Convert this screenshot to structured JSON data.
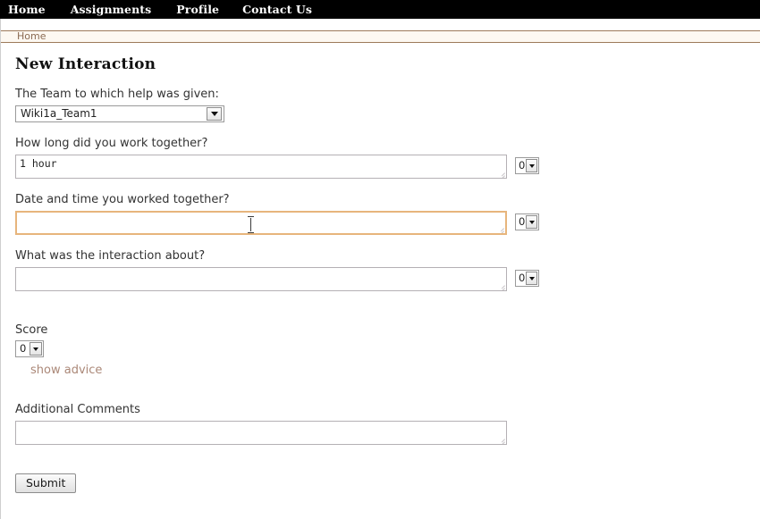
{
  "navbar": {
    "items": [
      {
        "label": "Home"
      },
      {
        "label": "Assignments"
      },
      {
        "label": "Profile"
      },
      {
        "label": "Contact Us"
      }
    ]
  },
  "breadcrumb": {
    "label": "Home"
  },
  "page": {
    "title": "New Interaction"
  },
  "form": {
    "team": {
      "label": "The Team to which help was given:",
      "value": "Wiki1a_Team1"
    },
    "duration": {
      "label": "How long did you work together?",
      "value": "1 hour",
      "placeholder": "",
      "counter": "0"
    },
    "datetime": {
      "label": "Date and time you worked together?",
      "value": "",
      "placeholder": "",
      "counter": "0"
    },
    "topic": {
      "label": "What was the interaction about?",
      "value": "",
      "placeholder": "",
      "counter": "0"
    },
    "score": {
      "label": "Score",
      "value": "0",
      "advice_link": "show advice"
    },
    "comments": {
      "label": "Additional Comments",
      "value": "",
      "placeholder": ""
    },
    "submit": {
      "label": "Submit"
    }
  },
  "colors": {
    "navbar_bg": "#000000",
    "breadcrumb_bg": "#fdf8f1",
    "breadcrumb_border": "#9d7a5a",
    "breadcrumb_text": "#8a6a52",
    "focus_border": "#e7b57c",
    "link_text": "#ab8878"
  }
}
